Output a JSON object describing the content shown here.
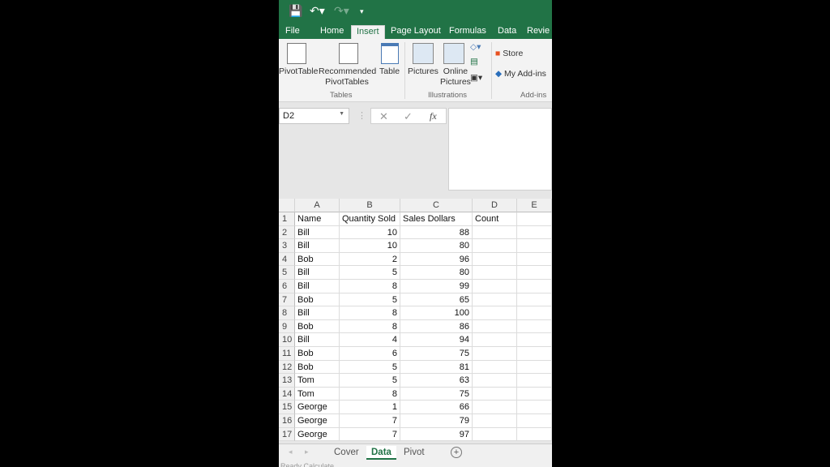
{
  "quick_access": {
    "save_icon": "save-icon",
    "undo_icon": "undo-icon",
    "redo_icon": "redo-icon",
    "customize_icon": "customize-icon"
  },
  "tabs": [
    "File",
    "Home",
    "Insert",
    "Page Layout",
    "Formulas",
    "Data",
    "Revie"
  ],
  "active_tab": "Insert",
  "ribbon": {
    "pivottable": "PivotTable",
    "recommended1": "Recommended",
    "recommended2": "PivotTables",
    "table": "Table",
    "tables_group": "Tables",
    "pictures": "Pictures",
    "online1": "Online",
    "online2": "Pictures",
    "illustrations_group": "Illustrations",
    "store": "Store",
    "my_addins": "My Add-ins",
    "addins_group": "Add-ins"
  },
  "formula_bar": {
    "name_box": "D2",
    "cancel": "✕",
    "enter": "✓",
    "fx": "fx",
    "value": ""
  },
  "columns": [
    "A",
    "B",
    "C",
    "D",
    "E"
  ],
  "rows": [
    [
      "Name",
      "Quantity Sold",
      "Sales Dollars",
      "Count",
      ""
    ],
    [
      "Bill",
      "10",
      "88",
      "",
      ""
    ],
    [
      "Bill",
      "10",
      "80",
      "",
      ""
    ],
    [
      "Bob",
      "2",
      "96",
      "",
      ""
    ],
    [
      "Bill",
      "5",
      "80",
      "",
      ""
    ],
    [
      "Bill",
      "8",
      "99",
      "",
      ""
    ],
    [
      "Bob",
      "5",
      "65",
      "",
      ""
    ],
    [
      "Bill",
      "8",
      "100",
      "",
      ""
    ],
    [
      "Bob",
      "8",
      "86",
      "",
      ""
    ],
    [
      "Bill",
      "4",
      "94",
      "",
      ""
    ],
    [
      "Bob",
      "6",
      "75",
      "",
      ""
    ],
    [
      "Bob",
      "5",
      "81",
      "",
      ""
    ],
    [
      "Tom",
      "5",
      "63",
      "",
      ""
    ],
    [
      "Tom",
      "8",
      "75",
      "",
      ""
    ],
    [
      "George",
      "1",
      "66",
      "",
      ""
    ],
    [
      "George",
      "7",
      "79",
      "",
      ""
    ],
    [
      "George",
      "7",
      "97",
      "",
      ""
    ]
  ],
  "sheets": [
    "Cover",
    "Data",
    "Pivot"
  ],
  "active_sheet": "Data",
  "status": "Ready  Calculate",
  "colors": {
    "accent": "#217346"
  }
}
